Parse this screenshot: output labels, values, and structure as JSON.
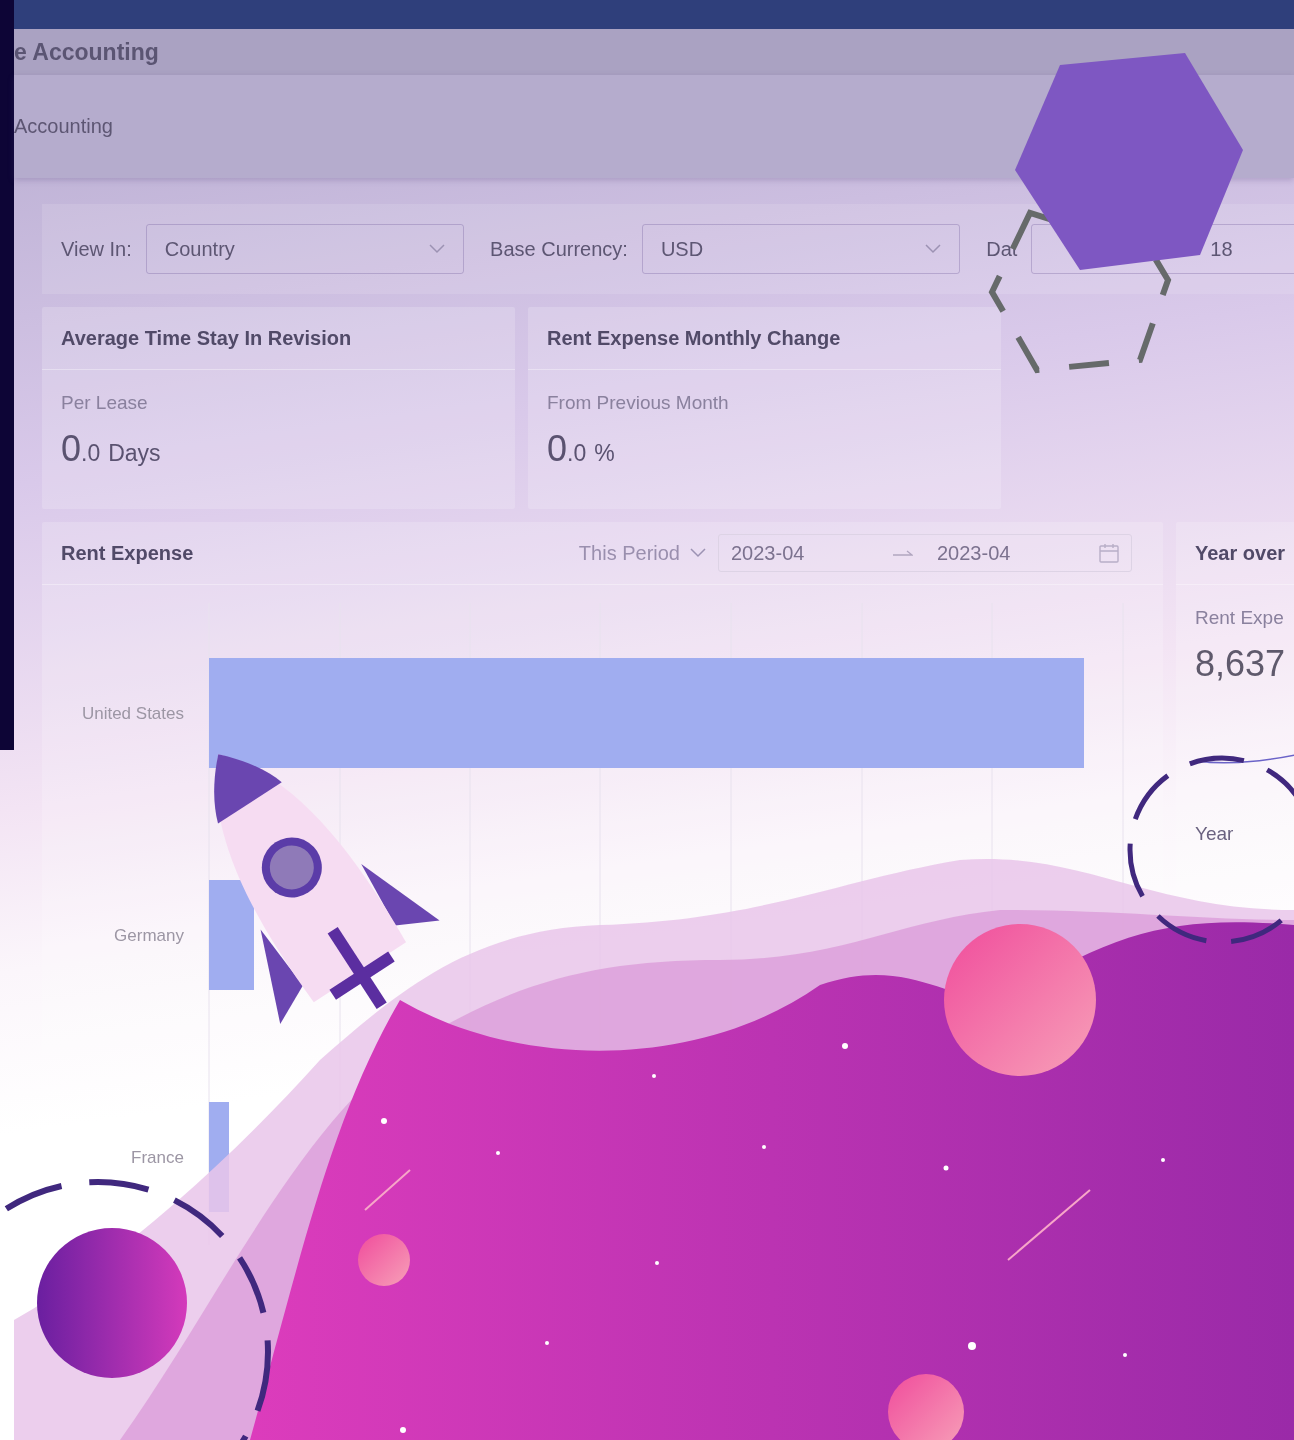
{
  "app_bar": {
    "title": "e Accounting"
  },
  "breadcrumb": {
    "label": "Accounting"
  },
  "filters": [
    {
      "label": "View In:",
      "value": "Country",
      "kind": "select"
    },
    {
      "label": "Base Currency:",
      "value": "USD",
      "kind": "select"
    },
    {
      "label": "Dat",
      "value": "18",
      "kind": "text"
    }
  ],
  "kpi_cards": [
    {
      "title": "Average Time Stay In Revision",
      "subtitle": "Per Lease",
      "integer": "0",
      "decimal": ".0",
      "unit": "Days"
    },
    {
      "title": "Rent Expense Monthly Change",
      "subtitle": "From Previous Month",
      "integer": "0",
      "decimal": ".0",
      "unit": "%"
    }
  ],
  "rent_expense": {
    "title": "Rent Expense",
    "period": "This Period",
    "start": "2023-04",
    "end": "2023-04",
    "categories": [
      "United States",
      "Germany",
      "France"
    ]
  },
  "side_card": {
    "title": "Year over",
    "label": "Rent Expe",
    "value": "8,637",
    "footer": "Year"
  }
}
